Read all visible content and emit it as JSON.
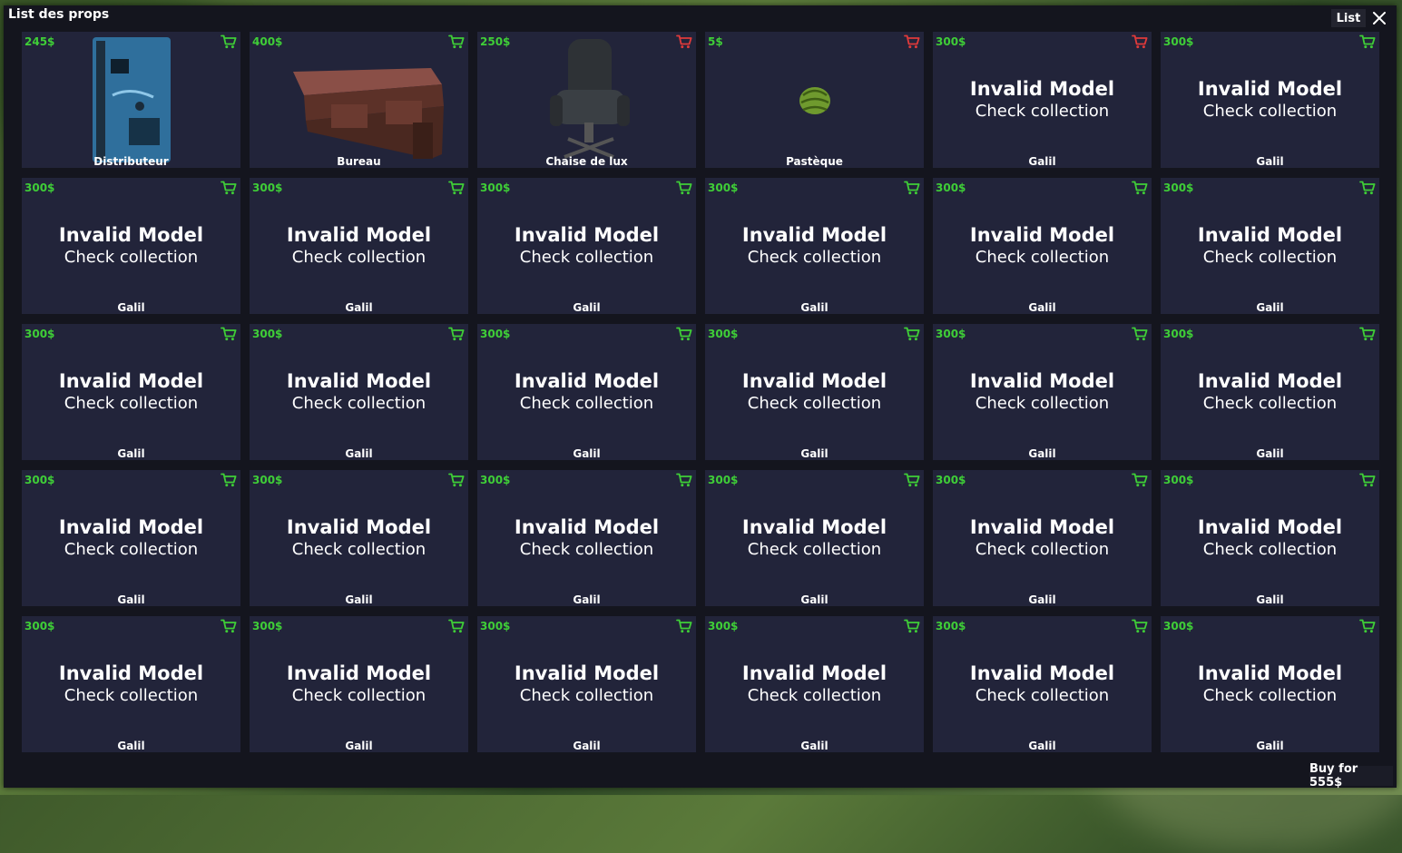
{
  "window": {
    "title": "List des props",
    "list_label": "List",
    "buy_label": "Buy for 555$"
  },
  "colors": {
    "panel": "#14151e",
    "card": "#22243a",
    "price": "#3fce37",
    "cart_ok": "#3fce37",
    "cart_blocked": "#e03a3a"
  },
  "invalid": {
    "title": "Invalid Model",
    "subtitle": "Check collection"
  },
  "props": [
    {
      "price": "245$",
      "name": "Distributeur",
      "cart": "green",
      "model": "vending-machine"
    },
    {
      "price": "400$",
      "name": "Bureau",
      "cart": "green",
      "model": "desk"
    },
    {
      "price": "250$",
      "name": "Chaise de lux",
      "cart": "red",
      "model": "office-chair"
    },
    {
      "price": "5$",
      "name": "Pastèque",
      "cart": "red",
      "model": "watermelon"
    },
    {
      "price": "300$",
      "name": "Galil",
      "cart": "red",
      "model": "invalid"
    },
    {
      "price": "300$",
      "name": "Galil",
      "cart": "green",
      "model": "invalid"
    },
    {
      "price": "300$",
      "name": "Galil",
      "cart": "green",
      "model": "invalid"
    },
    {
      "price": "300$",
      "name": "Galil",
      "cart": "green",
      "model": "invalid"
    },
    {
      "price": "300$",
      "name": "Galil",
      "cart": "green",
      "model": "invalid"
    },
    {
      "price": "300$",
      "name": "Galil",
      "cart": "green",
      "model": "invalid"
    },
    {
      "price": "300$",
      "name": "Galil",
      "cart": "green",
      "model": "invalid"
    },
    {
      "price": "300$",
      "name": "Galil",
      "cart": "green",
      "model": "invalid"
    },
    {
      "price": "300$",
      "name": "Galil",
      "cart": "green",
      "model": "invalid"
    },
    {
      "price": "300$",
      "name": "Galil",
      "cart": "green",
      "model": "invalid"
    },
    {
      "price": "300$",
      "name": "Galil",
      "cart": "green",
      "model": "invalid"
    },
    {
      "price": "300$",
      "name": "Galil",
      "cart": "green",
      "model": "invalid"
    },
    {
      "price": "300$",
      "name": "Galil",
      "cart": "green",
      "model": "invalid"
    },
    {
      "price": "300$",
      "name": "Galil",
      "cart": "green",
      "model": "invalid"
    },
    {
      "price": "300$",
      "name": "Galil",
      "cart": "green",
      "model": "invalid"
    },
    {
      "price": "300$",
      "name": "Galil",
      "cart": "green",
      "model": "invalid"
    },
    {
      "price": "300$",
      "name": "Galil",
      "cart": "green",
      "model": "invalid"
    },
    {
      "price": "300$",
      "name": "Galil",
      "cart": "green",
      "model": "invalid"
    },
    {
      "price": "300$",
      "name": "Galil",
      "cart": "green",
      "model": "invalid"
    },
    {
      "price": "300$",
      "name": "Galil",
      "cart": "green",
      "model": "invalid"
    },
    {
      "price": "300$",
      "name": "Galil",
      "cart": "green",
      "model": "invalid"
    },
    {
      "price": "300$",
      "name": "Galil",
      "cart": "green",
      "model": "invalid"
    },
    {
      "price": "300$",
      "name": "Galil",
      "cart": "green",
      "model": "invalid"
    },
    {
      "price": "300$",
      "name": "Galil",
      "cart": "green",
      "model": "invalid"
    },
    {
      "price": "300$",
      "name": "Galil",
      "cart": "green",
      "model": "invalid"
    },
    {
      "price": "300$",
      "name": "Galil",
      "cart": "green",
      "model": "invalid"
    }
  ]
}
